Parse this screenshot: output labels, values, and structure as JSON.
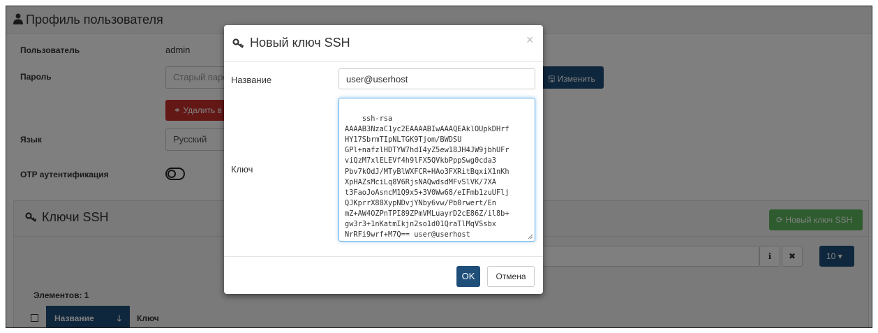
{
  "profile": {
    "title": "Профиль пользователя",
    "user_label": "Пользователь",
    "user_value": "admin",
    "password_label": "Пароль",
    "old_password_placeholder": "Старый пароль",
    "change_button": "Изменить",
    "delete_button": "Удалить в",
    "language_label": "Язык",
    "language_value": "Русский",
    "otp_label": "OTP аутентификация"
  },
  "ssh": {
    "title": "Ключи SSH",
    "new_key_button": "Новый ключ SSH",
    "page_size": "10",
    "elements_label": "Элементов: 1",
    "columns": [
      "Название",
      "Ключ"
    ]
  },
  "modal": {
    "title": "Новый ключ SSH",
    "close": "×",
    "name_label": "Название",
    "name_value": "user@userhost",
    "key_label": "Ключ",
    "key_value": "ssh-rsa\nAAAAB3NzaC1yc2EAAAABIwAAAQEAklOUpkDHrf\nHY17SbrmTIpNLTGK9Tjom/BWDSU\nGPl+nafzlHDTYW7hdI4yZ5ew18JH4JW9jbhUFr\nviQzM7xlELEVf4h9lFX5QVkbPppSwg0cda3\nPbv7kOdJ/MTyBlWXFCR+HAo3FXRitBqxiX1nKh\nXpHAZsMciLq8V6RjsNAQwdsdMFvSlVK/7XA\nt3FaoJoAsncM1Q9x5+3V0Ww68/eIFmb1zuUFlj\nQJKprrX88XypNDvjYNby6vw/Pb0rwert/En\nmZ+AW4OZPnTPI89ZPmVMLuayrD2cE86Z/il8b+\ngw3r3+1nKatmIkjn2so1d01QraTlMqVSsbx\nNrRFi9wrf+M7Q== user@userhost",
    "ok_button": "OK",
    "cancel_button": "Отмена"
  }
}
